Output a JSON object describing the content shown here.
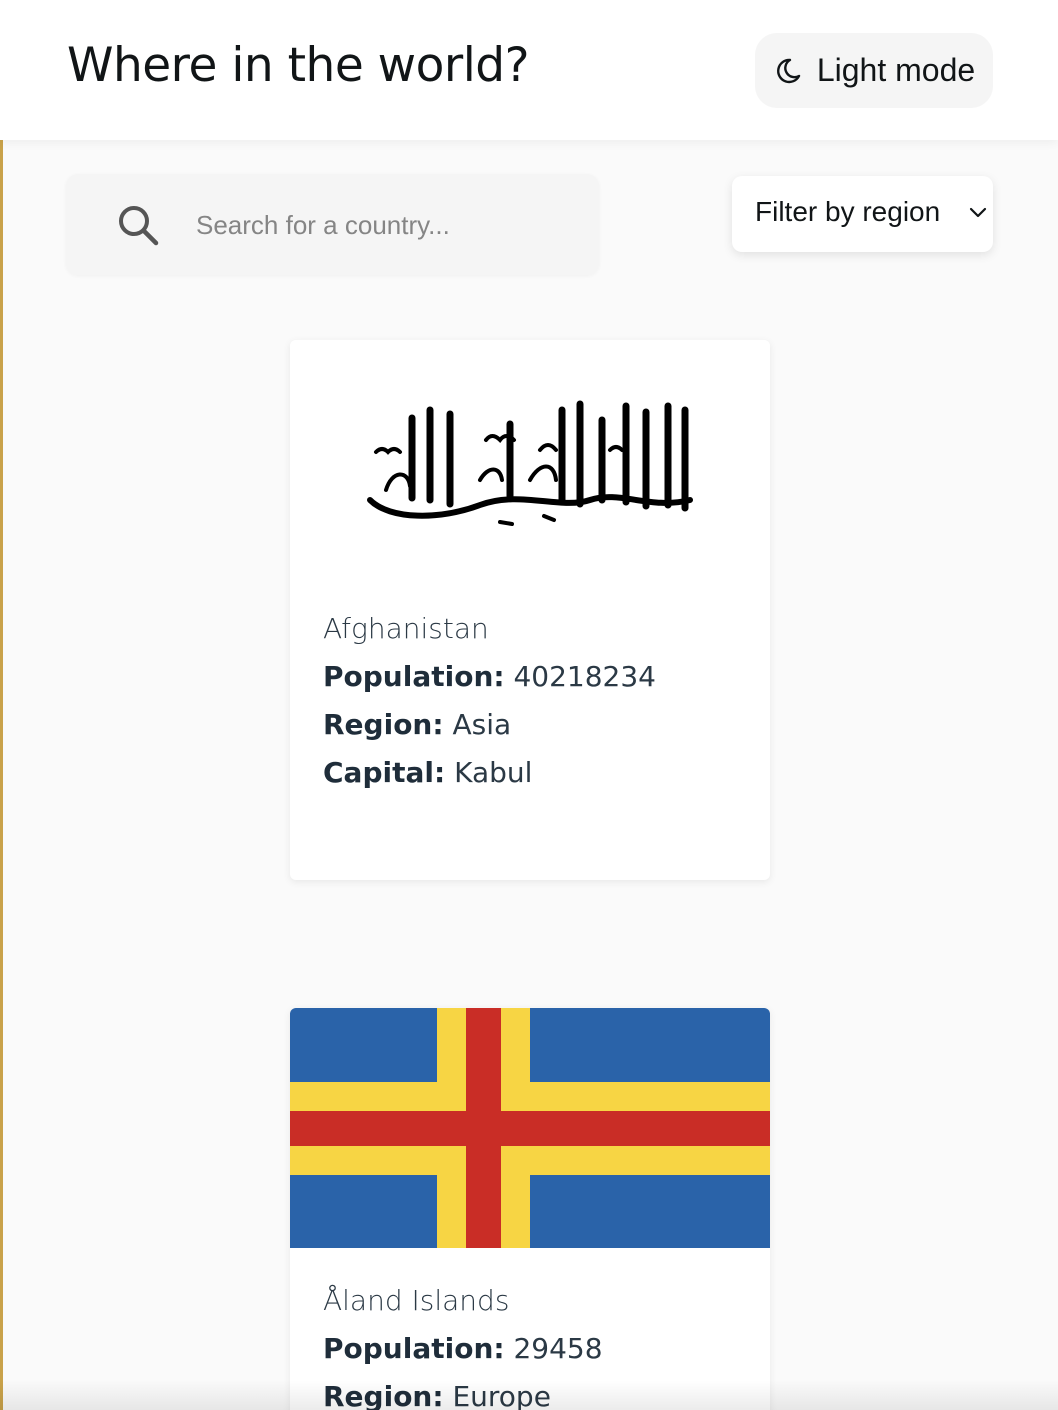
{
  "header": {
    "title": "Where in the world?",
    "theme_toggle_label": "Light mode",
    "theme_icon": "moon-icon"
  },
  "search": {
    "placeholder": "Search for a country...",
    "value": "",
    "icon": "search-icon"
  },
  "filter": {
    "label": "Filter by region",
    "icon": "chevron-down-icon"
  },
  "labels": {
    "population": "Population:",
    "region": "Region:",
    "capital": "Capital:"
  },
  "countries": [
    {
      "name": "Afghanistan",
      "population": "40218234",
      "region": "Asia",
      "capital": "Kabul",
      "flag": "afghanistan-flag"
    },
    {
      "name": "Åland Islands",
      "population": "29458",
      "region": "Europe",
      "flag": "aland-islands-flag"
    }
  ],
  "colors": {
    "background": "#fafafa",
    "card": "#ffffff",
    "text": "#111517",
    "aland_blue": "#2a63a9",
    "aland_yellow": "#f7d544",
    "aland_red": "#c92d26"
  }
}
